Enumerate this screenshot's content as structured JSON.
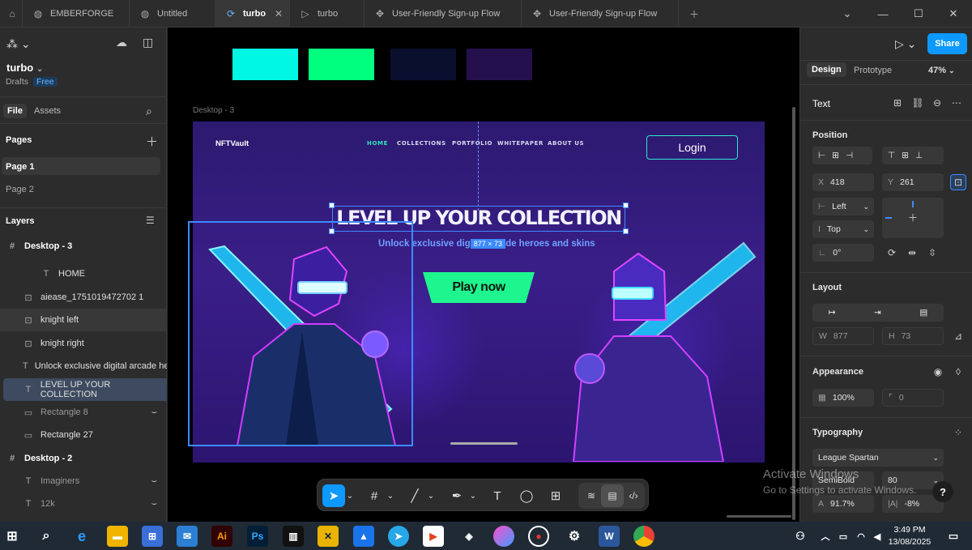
{
  "tabs": [
    {
      "label": "EMBERFORGE",
      "icon": "globe-icon"
    },
    {
      "label": "Untitled",
      "icon": "globe-icon"
    },
    {
      "label": "turbo",
      "icon": "figma-file-icon"
    },
    {
      "label": "turbo",
      "icon": "play-icon"
    },
    {
      "label": "User-Friendly Sign-up Flow",
      "icon": "component-icon"
    },
    {
      "label": "User-Friendly Sign-up Flow",
      "icon": "component-icon"
    }
  ],
  "file": {
    "name": "turbo",
    "location": "Drafts",
    "plan": "Free"
  },
  "left_tabs": {
    "file": "File",
    "assets": "Assets"
  },
  "pages": {
    "heading": "Pages",
    "items": [
      "Page 1",
      "Page 2"
    ]
  },
  "layers": {
    "heading": "Layers",
    "items": [
      {
        "label": "Desktop - 3",
        "icon": "frame-icon"
      },
      {
        "label": "HOME",
        "icon": "text-icon"
      },
      {
        "label": "aiease_1751019472702 1",
        "icon": "image-icon"
      },
      {
        "label": "knight left",
        "icon": "image-icon"
      },
      {
        "label": "knight right",
        "icon": "image-icon"
      },
      {
        "label": "Unlock exclusive digital arcade he",
        "icon": "text-icon"
      },
      {
        "label": "LEVEL UP YOUR COLLECTION",
        "icon": "text-icon"
      },
      {
        "label": "Rectangle 8",
        "icon": "rect-icon"
      },
      {
        "label": "Rectangle 27",
        "icon": "rect-icon"
      },
      {
        "label": "Desktop - 2",
        "icon": "frame-icon"
      },
      {
        "label": "Imaginers",
        "icon": "text-icon"
      },
      {
        "label": "12k",
        "icon": "text-icon"
      }
    ]
  },
  "swatches": [
    "#00f7e4",
    "#00ff7f",
    "#0a0f2e",
    "#25104e"
  ],
  "canvas": {
    "frame_label": "Desktop - 3",
    "size_badge": "877 × 73"
  },
  "design": {
    "brand": "NFTVault",
    "nav": [
      "HOME",
      "COLLECTIONS",
      "PORTFOLIO",
      "WHITEPAPER",
      "ABOUT US"
    ],
    "login": "Login",
    "headline": "LEVEL UP YOUR COLLECTION",
    "subline_a": "Unlock exclusive dig",
    "subline_b": "de heroes and skins",
    "cta": "Play now"
  },
  "right": {
    "share": "Share",
    "tabs": {
      "design": "Design",
      "prototype": "Prototype"
    },
    "zoom": "47%",
    "layer_type": "Text",
    "position": {
      "heading": "Position",
      "x_label": "X",
      "x": "418",
      "y_label": "Y",
      "y": "261",
      "h_align": "Left",
      "v_align": "Top",
      "rotation": "0°"
    },
    "layout": {
      "heading": "Layout",
      "w_label": "W",
      "w": "877",
      "h_label": "H",
      "h": "73"
    },
    "appearance": {
      "heading": "Appearance",
      "opacity": "100%",
      "radius": "0"
    },
    "typography": {
      "heading": "Typography",
      "font": "League Spartan",
      "weight": "SemiBold",
      "size": "80",
      "line_height": "91.7%",
      "letter_spacing": "-8%"
    }
  },
  "watermark": {
    "line1": "Activate Windows",
    "line2": "Go to Settings to activate Windows."
  },
  "taskbar": {
    "time": "3:49 PM",
    "date": "13/08/2025"
  }
}
